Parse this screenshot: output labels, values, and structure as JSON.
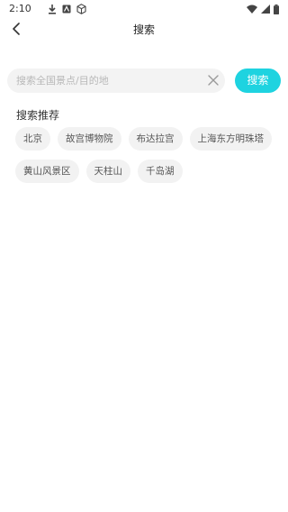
{
  "status_bar": {
    "time": "2:10",
    "left_icons": [
      "download-icon",
      "app-notification-icon",
      "cube-icon"
    ],
    "right_icons": [
      "wifi-icon",
      "signal-icon",
      "battery-icon"
    ]
  },
  "header": {
    "back_icon": "chevron-left-icon",
    "title": "搜索"
  },
  "search": {
    "value": "",
    "placeholder": "搜索全国景点/目的地",
    "clear_icon": "close-icon",
    "button_label": "搜索"
  },
  "recommend": {
    "title": "搜索推荐",
    "items": [
      {
        "label": "北京"
      },
      {
        "label": "故宫博物院"
      },
      {
        "label": "布达拉宫"
      },
      {
        "label": "上海东方明珠塔"
      },
      {
        "label": "黄山风景区"
      },
      {
        "label": "天柱山"
      },
      {
        "label": "千岛湖"
      }
    ]
  },
  "colors": {
    "accent": "#1ed3e0",
    "tag_bg": "#f2f2f2",
    "input_bg": "#f3f3f3"
  }
}
